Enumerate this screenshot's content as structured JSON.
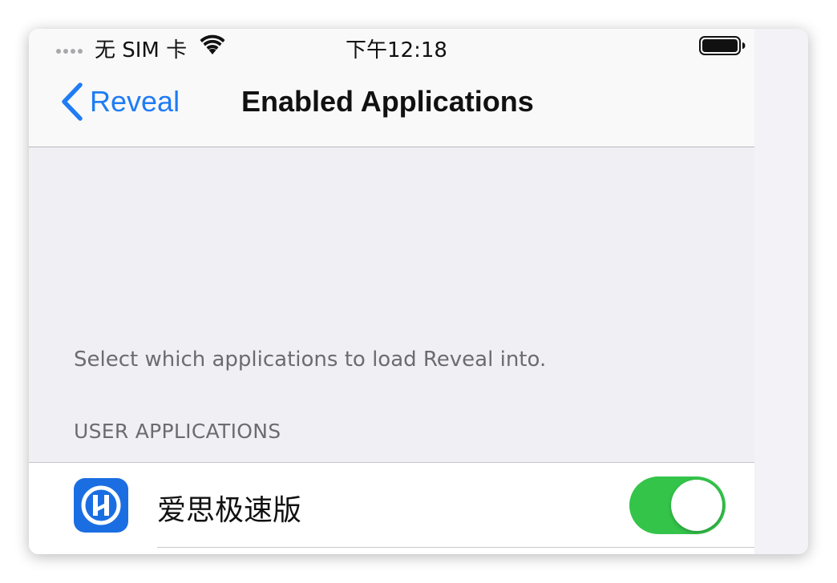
{
  "status_bar": {
    "carrier": "无 SIM 卡",
    "time": "下午12:18"
  },
  "nav": {
    "back_label": "Reveal",
    "title": "Enabled Applications"
  },
  "content": {
    "explanation": "Select which applications to load Reveal into.",
    "section_header": "USER APPLICATIONS",
    "apps": [
      {
        "name": "爱思极速版",
        "enabled": true,
        "icon": "aisi-app-icon"
      }
    ]
  },
  "colors": {
    "accent": "#1f7cf4",
    "toggle_on": "#34c44a",
    "app_icon": "#1b6ee2"
  }
}
